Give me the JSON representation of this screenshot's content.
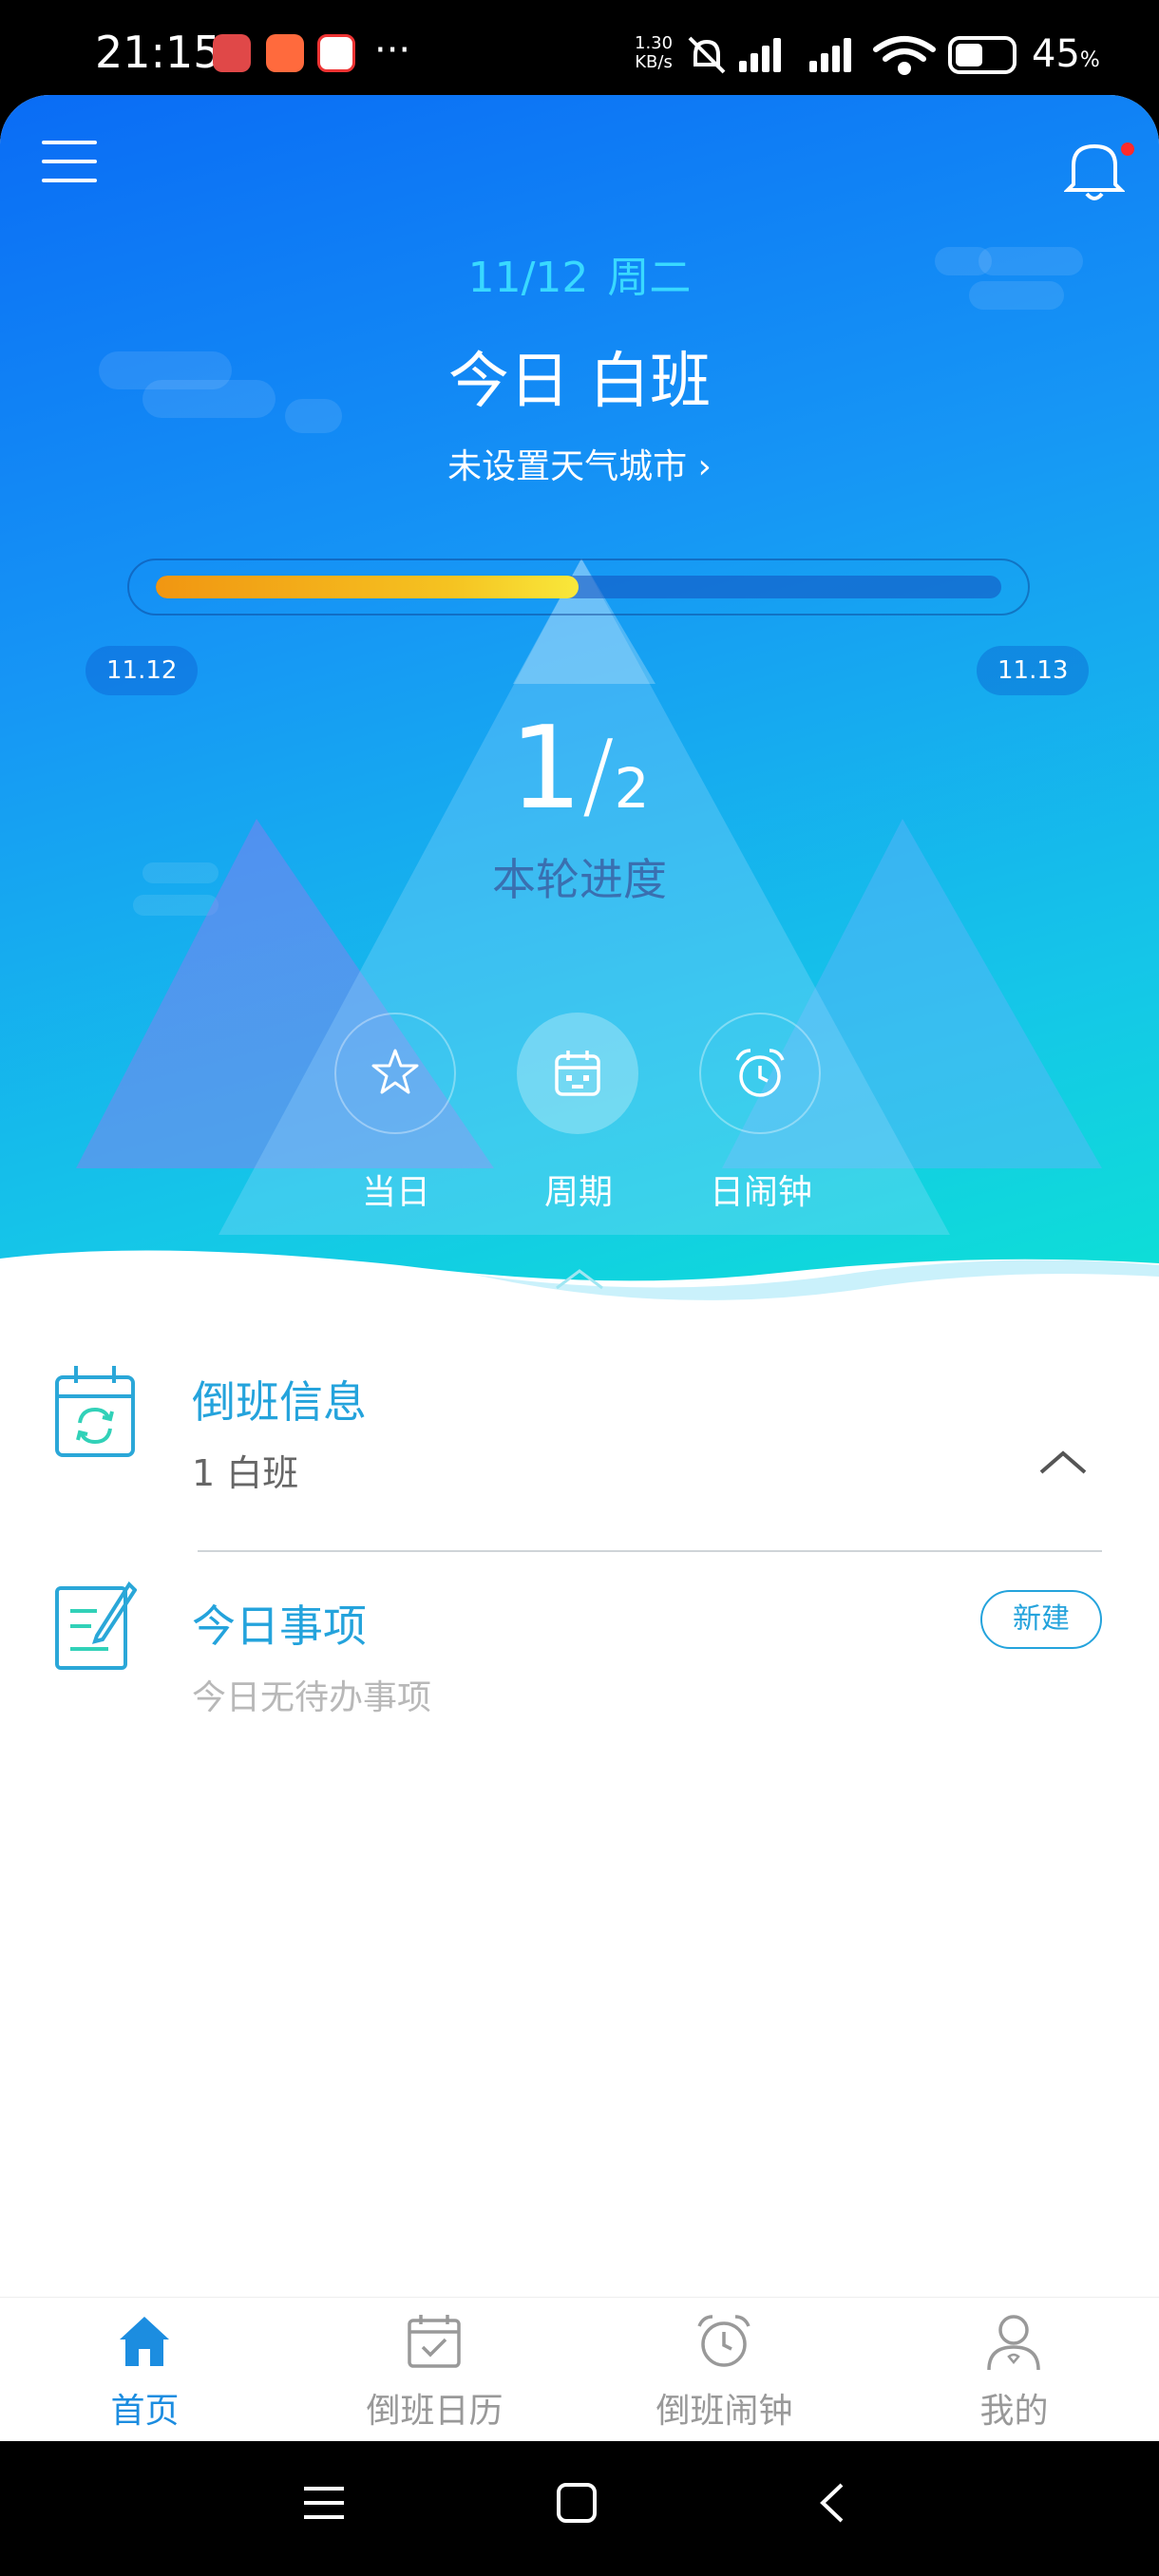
{
  "status_bar": {
    "time": "21:15",
    "net_speed": "1.30",
    "net_unit": "KB/s",
    "battery": "45",
    "battery_unit": "%"
  },
  "header": {
    "date": "11/12",
    "weekday": "周二",
    "today_shift": "今日 白班",
    "weather_link": "未设置天气城市 ›"
  },
  "progress": {
    "fraction": 0.5,
    "start_label": "11.12",
    "end_label": "11.13",
    "current": "1",
    "total": "2",
    "caption": "本轮进度"
  },
  "hero_buttons": [
    {
      "label": "当日",
      "icon": "star-icon"
    },
    {
      "label": "周期",
      "icon": "calendar-icon"
    },
    {
      "label": "日闹钟",
      "icon": "alarm-clock-icon"
    }
  ],
  "shift_info": {
    "title": "倒班信息",
    "value": "1 白班"
  },
  "todo": {
    "title": "今日事项",
    "empty_text": "今日无待办事项",
    "new_label": "新建"
  },
  "bottom_nav": [
    {
      "label": "首页",
      "icon": "home-icon",
      "active": true
    },
    {
      "label": "倒班日历",
      "icon": "calendar-check-icon"
    },
    {
      "label": "倒班闹钟",
      "icon": "alarm-clock-icon"
    },
    {
      "label": "我的",
      "icon": "user-icon"
    }
  ],
  "colors": {
    "accent": "#24a3dc",
    "nav_active": "#1c8de0",
    "date_cyan": "#39d9ff"
  }
}
